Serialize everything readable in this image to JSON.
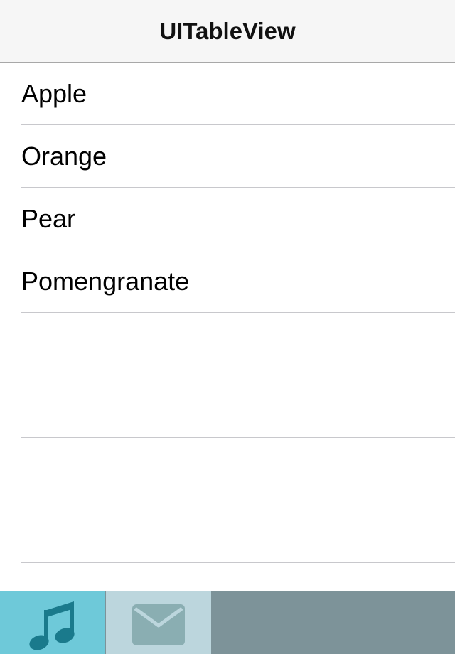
{
  "navbar": {
    "title": "UITableView"
  },
  "table": {
    "rows": [
      {
        "label": "Apple"
      },
      {
        "label": "Orange"
      },
      {
        "label": "Pear"
      },
      {
        "label": "Pomengranate"
      },
      {
        "label": ""
      },
      {
        "label": ""
      },
      {
        "label": ""
      },
      {
        "label": ""
      },
      {
        "label": ""
      }
    ]
  },
  "tabbar": {
    "items": [
      {
        "icon": "music-note-icon",
        "selected": true
      },
      {
        "icon": "mail-envelope-icon",
        "selected": false
      }
    ]
  },
  "colors": {
    "navbar_bg": "#f6f6f6",
    "tab_selected_bg": "#6ec9d9",
    "tab_unselected_bg": "#bcd6dd",
    "tabbar_bg": "#7d9399",
    "music_icon": "#1a7a8c",
    "mail_icon": "#8aaeb2"
  }
}
